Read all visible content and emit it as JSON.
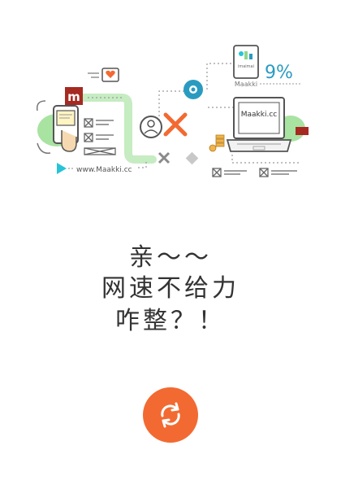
{
  "illustration": {
    "site_url_label": "www.Maakki.cc",
    "laptop_screen_text": "Maakki.cc",
    "tablet_caption": "Maakki",
    "tablet_app_label": "imaimai",
    "percent_text": "9%",
    "logo_letter": "m",
    "accent_color": "#f26a32",
    "green_color": "#8fd68a",
    "cyan_color": "#29c3d8"
  },
  "message": {
    "line1": "亲～～",
    "line2": "网速不给力",
    "line3": "咋整？！"
  },
  "refresh_button": {
    "icon": "refresh-icon",
    "color": "#f26a32"
  }
}
